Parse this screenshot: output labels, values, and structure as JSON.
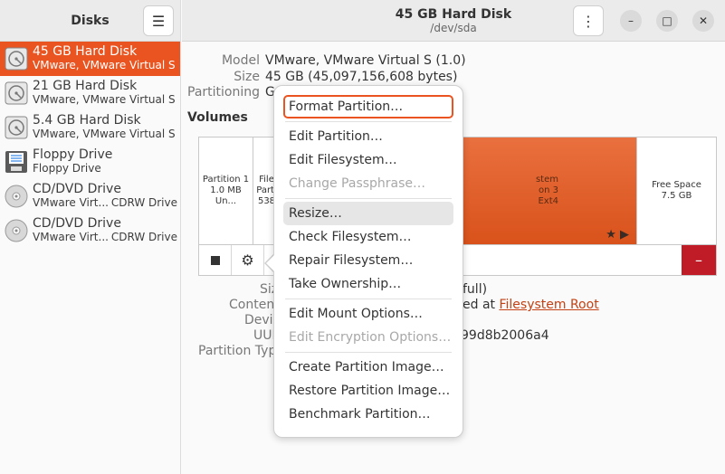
{
  "left_header": {
    "title": "Disks",
    "menu_icon": "hamburger-icon"
  },
  "drives": [
    {
      "name": "45 GB Hard Disk",
      "sub": "VMware, VMware Virtual S",
      "sub2": "",
      "icon": "hard-disk-icon",
      "selected": true
    },
    {
      "name": "21 GB Hard Disk",
      "sub": "VMware, VMware Virtual S",
      "sub2": "",
      "icon": "hard-disk-icon",
      "selected": false
    },
    {
      "name": "5.4 GB Hard Disk",
      "sub": "VMware, VMware Virtual S",
      "sub2": "",
      "icon": "hard-disk-icon",
      "selected": false
    },
    {
      "name": "Floppy Drive",
      "sub": "Floppy Drive",
      "sub2": "",
      "icon": "floppy-icon",
      "selected": false
    },
    {
      "name": "CD/DVD Drive",
      "sub": "VMware Virt...",
      "sub2": "CDRW Drive",
      "icon": "optical-disc-icon",
      "selected": false
    },
    {
      "name": "CD/DVD Drive",
      "sub": "VMware Virt...",
      "sub2": "CDRW Drive",
      "icon": "optical-disc-icon",
      "selected": false
    }
  ],
  "right_header": {
    "title": "45 GB Hard Disk",
    "subtitle": "/dev/sda"
  },
  "disk_info": {
    "model_label": "Model",
    "model_value": "VMware, VMware Virtual S (1.0)",
    "size_label": "Size",
    "size_value": "45 GB (45,097,156,608 bytes)",
    "partitioning_label": "Partitioning",
    "partitioning_value": "G"
  },
  "volumes_title": "Volumes",
  "segments": {
    "p1_name": "Partition 1",
    "p1_size": "1.0 MB Un...",
    "p2_line1": "File",
    "p2_line2": "Parti",
    "p2_line3": "538",
    "p3_line1": "stem",
    "p3_line2": "on 3",
    "p3_line3": "Ext4",
    "free_name": "Free Space",
    "free_size": "7.5 GB"
  },
  "details": {
    "size_label": "Siz",
    "size_value": "full)",
    "contents_label": "Conten",
    "contents_prefix": "ed at ",
    "contents_link": "Filesystem Root",
    "device_label": "Devic",
    "uuid_label": "UUI",
    "uuid_value": "99d8b2006a4",
    "type_label": "Partition Typ"
  },
  "menu": {
    "items": [
      {
        "label": "Format Partition…",
        "state": "focused"
      },
      {
        "sep": true
      },
      {
        "label": "Edit Partition…",
        "state": "normal"
      },
      {
        "label": "Edit Filesystem…",
        "state": "normal"
      },
      {
        "label": "Change Passphrase…",
        "state": "disabled"
      },
      {
        "sep": true
      },
      {
        "label": "Resize…",
        "state": "hover"
      },
      {
        "label": "Check Filesystem…",
        "state": "normal"
      },
      {
        "label": "Repair Filesystem…",
        "state": "normal"
      },
      {
        "label": "Take Ownership…",
        "state": "normal"
      },
      {
        "sep": true
      },
      {
        "label": "Edit Mount Options…",
        "state": "normal"
      },
      {
        "label": "Edit Encryption Options…",
        "state": "disabled"
      },
      {
        "sep": true
      },
      {
        "label": "Create Partition Image…",
        "state": "normal"
      },
      {
        "label": "Restore Partition Image…",
        "state": "normal"
      },
      {
        "label": "Benchmark Partition…",
        "state": "normal"
      }
    ]
  },
  "colors": {
    "accent": "#e95420",
    "danger": "#c01c28"
  }
}
